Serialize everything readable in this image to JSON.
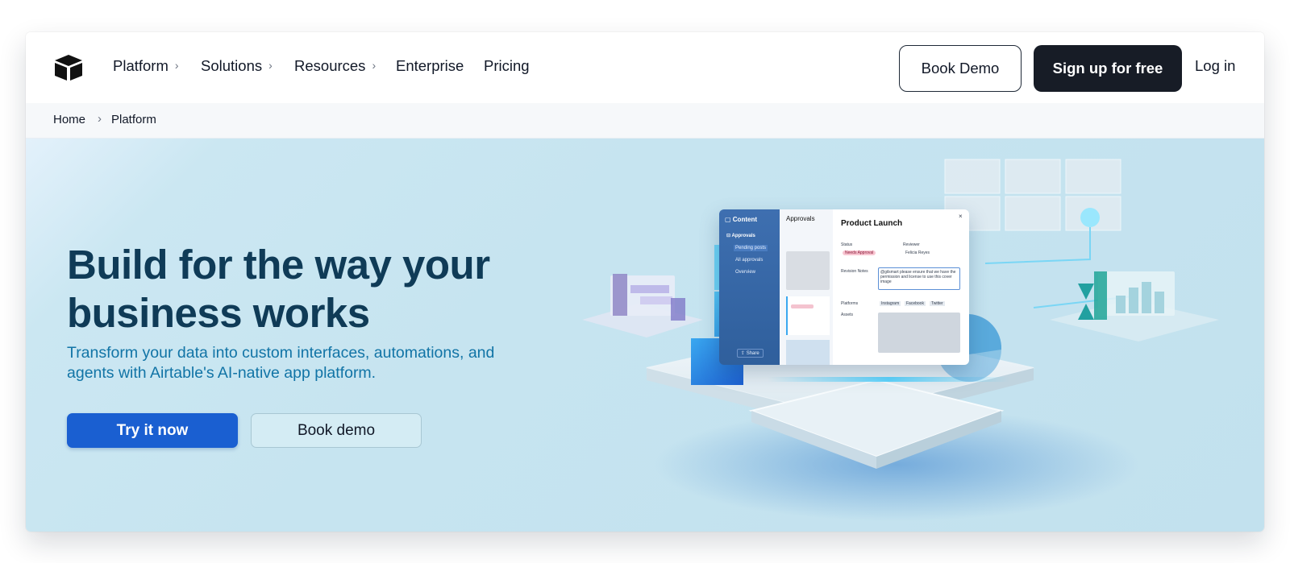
{
  "nav": {
    "items": [
      {
        "label": "Platform",
        "has_submenu": true
      },
      {
        "label": "Solutions",
        "has_submenu": true
      },
      {
        "label": "Resources",
        "has_submenu": true
      },
      {
        "label": "Enterprise",
        "has_submenu": false
      },
      {
        "label": "Pricing",
        "has_submenu": false
      }
    ],
    "chevron": "›",
    "book_demo": "Book Demo",
    "signup": "Sign up for free",
    "login": "Log in"
  },
  "breadcrumb": {
    "items": [
      "Home",
      "Platform"
    ],
    "separator": "›"
  },
  "hero": {
    "headline": "Build for the way your business works",
    "subline": "Transform your data into custom interfaces, automations, and agents with Airtable's AI-native app platform.",
    "primary_cta": "Try it now",
    "secondary_cta": "Book demo"
  },
  "illustration": {
    "sidebar": {
      "title": "Content",
      "section": "Approvals",
      "items": [
        "Pending posts",
        "All approvals",
        "Overview"
      ],
      "share": "Share"
    },
    "list_title": "Approvals",
    "detail": {
      "title": "Product Launch",
      "close": "×",
      "status_label": "Status",
      "status_value": "Needs Approval",
      "reviewer_label": "Reviewer",
      "reviewer_value": "Felicia Reyes",
      "notes_label": "Revision Notes",
      "notes_value": "@gilsmart please ensure that we have the permission and license to use this cover image",
      "platforms_label": "Platforms",
      "platforms": [
        "Instagram",
        "Facebook",
        "Twitter"
      ],
      "assets_label": "Assets"
    }
  },
  "colors": {
    "primary": "#1a5fd1",
    "dark_button": "#171c26",
    "headline": "#0f3b57",
    "subline": "#1174a6",
    "hero_bg": "#c6e4f0"
  }
}
